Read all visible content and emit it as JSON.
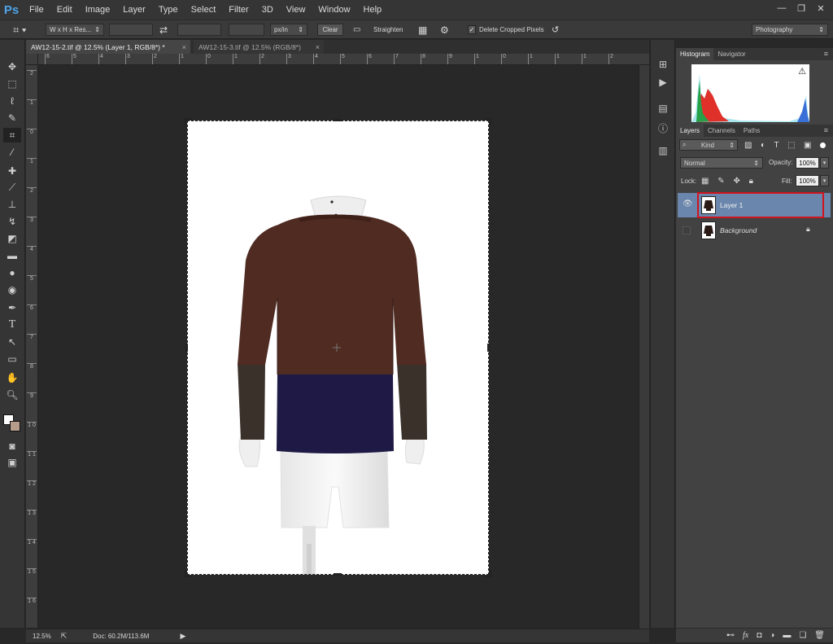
{
  "app": {
    "logo": "Ps"
  },
  "menu": [
    "File",
    "Edit",
    "Image",
    "Layer",
    "Type",
    "Select",
    "Filter",
    "3D",
    "View",
    "Window",
    "Help"
  ],
  "window_controls": {
    "minimize": "—",
    "restore": "❐",
    "close": "✕"
  },
  "options": {
    "ratio_dropdown": "W x H x Res...",
    "units_dropdown": "px/in",
    "clear_label": "Clear",
    "straighten_label": "Straighten",
    "delete_cropped_label": "Delete Cropped Pixels",
    "delete_cropped_checked": true,
    "workspace": "Photography"
  },
  "tabs": [
    {
      "label": "AW12-15-2.tif @ 12.5% (Layer 1, RGB/8*) *",
      "active": true
    },
    {
      "label": "AW12-15-3.tif @ 12.5% (RGB/8*)",
      "active": false
    }
  ],
  "ruler": {
    "top": [
      "6",
      "5",
      "4",
      "3",
      "2",
      "1",
      "0",
      "1",
      "2",
      "3",
      "4",
      "5",
      "6",
      "7",
      "8",
      "9",
      "1",
      "0",
      "1",
      "1",
      "1",
      "2"
    ],
    "left": [
      "2",
      "1",
      "0",
      "1",
      "2",
      "3",
      "4",
      "5",
      "6",
      "7",
      "8",
      "9",
      "1 0",
      "1 1",
      "1 2",
      "1 3",
      "1 4",
      "1 5",
      "1 6"
    ]
  },
  "status": {
    "zoom": "12.5%",
    "doc": "Doc: 60.2M/113.6M"
  },
  "histogram_panel": {
    "tabs": [
      "Histogram",
      "Navigator"
    ],
    "warning_icon": "⚠"
  },
  "layers_panel": {
    "tabs": [
      "Layers",
      "Channels",
      "Paths"
    ],
    "filter_kind": "Kind",
    "blend_mode": "Normal",
    "opacity_label": "Opacity:",
    "opacity_value": "100%",
    "lock_label": "Lock:",
    "fill_label": "Fill:",
    "fill_value": "100%",
    "layers": [
      {
        "name": "Layer 1",
        "visible": true,
        "selected": true
      },
      {
        "name": "Background",
        "visible": false,
        "selected": false,
        "locked": true
      }
    ]
  },
  "colors": {
    "selected_layer": "#6a86ad",
    "highlight_red": "#d0141e",
    "sweater_brown": "#4f2b22",
    "sweater_navy": "#1e1a45"
  }
}
